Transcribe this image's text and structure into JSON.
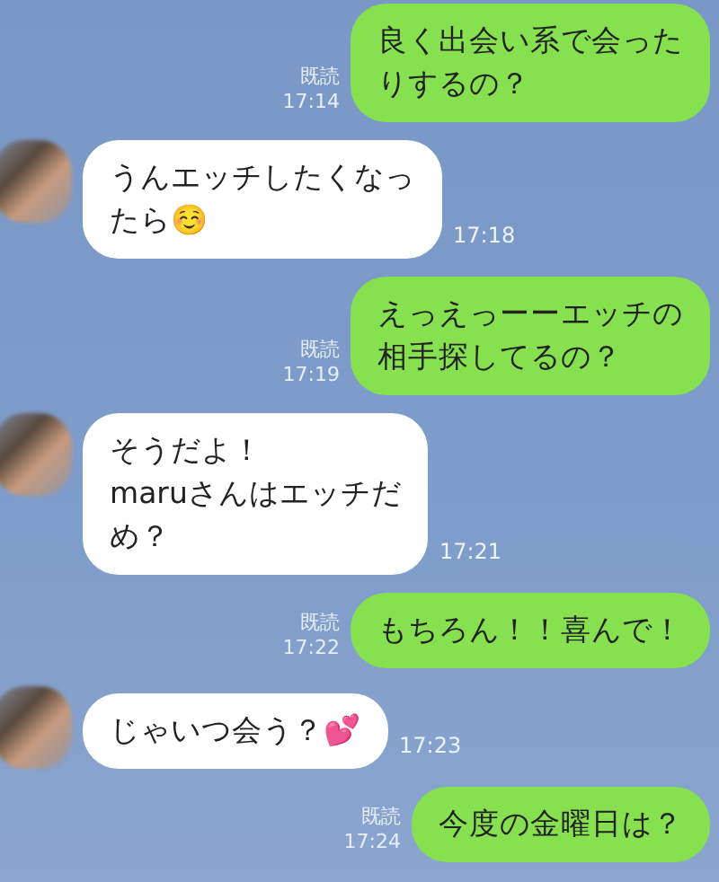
{
  "messages": [
    {
      "kind": "sent",
      "lines": [
        "良く出会い系で会った",
        "りするの？"
      ],
      "read_label": "既読",
      "time": "17:14"
    },
    {
      "kind": "received",
      "lines": [
        "うんエッチしたくなっ",
        "たら☺️"
      ],
      "time": "17:18"
    },
    {
      "kind": "sent",
      "lines": [
        "えっえっーーエッチの",
        "相手探してるの？"
      ],
      "read_label": "既読",
      "time": "17:19"
    },
    {
      "kind": "received",
      "lines": [
        "そうだよ！",
        "maruさんはエッチだ",
        "め？"
      ],
      "time": "17:21"
    },
    {
      "kind": "sent",
      "lines": [
        "もちろん！！喜んで！"
      ],
      "read_label": "既読",
      "time": "17:22"
    },
    {
      "kind": "received",
      "lines": [
        "じゃいつ会う？💕"
      ],
      "time": "17:23"
    },
    {
      "kind": "sent",
      "lines": [
        "今度の金曜日は？"
      ],
      "read_label": "既読",
      "time": "17:24"
    }
  ]
}
